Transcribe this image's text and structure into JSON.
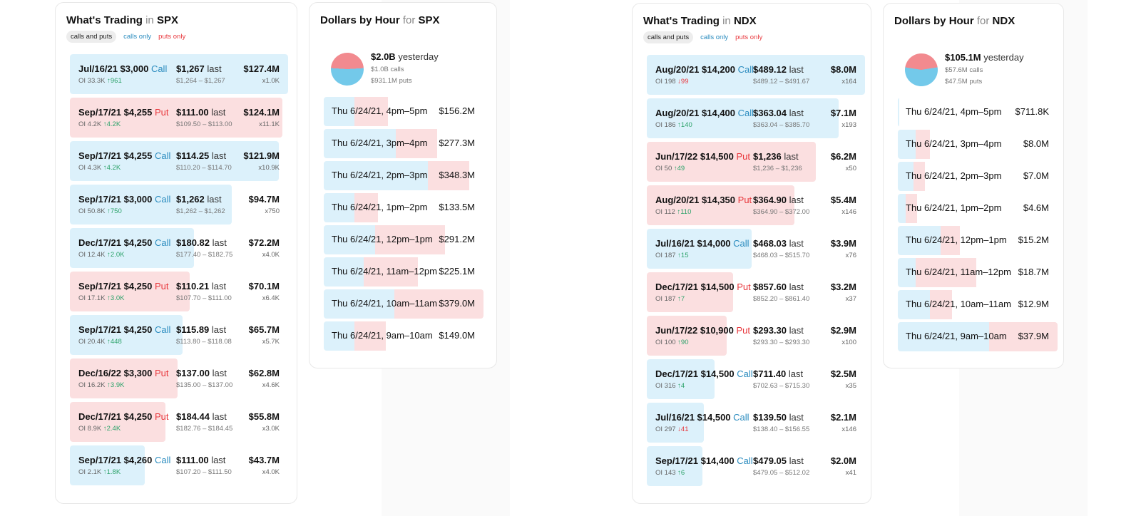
{
  "spx": {
    "trading": {
      "title_pre": "What's Trading",
      "title_sep": "in",
      "ticker": "SPX",
      "filters": {
        "all": "calls and puts",
        "calls": "calls only",
        "puts": "puts only"
      },
      "rows": [
        {
          "contract": "Jul/16/21 $3,000",
          "type": "Call",
          "oi": "OI 33.3K",
          "change_dir": "up",
          "change": "961",
          "last": "$1,267",
          "last_label": "last",
          "range": "$1,264 – $1,267",
          "premium": "$127.4M",
          "multiple": "x1.0K",
          "bar_fraction": 1.0
        },
        {
          "contract": "Sep/17/21 $4,255",
          "type": "Put",
          "oi": "OI 4.2K",
          "change_dir": "up",
          "change": "4.2K",
          "last": "$111.00",
          "last_label": "last",
          "range": "$109.50 – $113.00",
          "premium": "$124.1M",
          "multiple": "x11.1K",
          "bar_fraction": 0.974
        },
        {
          "contract": "Sep/17/21 $4,255",
          "type": "Call",
          "oi": "OI 4.3K",
          "change_dir": "up",
          "change": "4.2K",
          "last": "$114.25",
          "last_label": "last",
          "range": "$110.20 – $114.70",
          "premium": "$121.9M",
          "multiple": "x10.9K",
          "bar_fraction": 0.957
        },
        {
          "contract": "Sep/17/21 $3,000",
          "type": "Call",
          "oi": "OI 50.8K",
          "change_dir": "up",
          "change": "750",
          "last": "$1,262",
          "last_label": "last",
          "range": "$1,262 – $1,262",
          "premium": "$94.7M",
          "multiple": "x750",
          "bar_fraction": 0.743
        },
        {
          "contract": "Dec/17/21 $4,250",
          "type": "Call",
          "oi": "OI 12.4K",
          "change_dir": "up",
          "change": "2.0K",
          "last": "$180.82",
          "last_label": "last",
          "range": "$177.40 – $182.75",
          "premium": "$72.2M",
          "multiple": "x4.0K",
          "bar_fraction": 0.567
        },
        {
          "contract": "Sep/17/21 $4,250",
          "type": "Put",
          "oi": "OI 17.1K",
          "change_dir": "up",
          "change": "3.0K",
          "last": "$110.21",
          "last_label": "last",
          "range": "$107.70 – $111.00",
          "premium": "$70.1M",
          "multiple": "x6.4K",
          "bar_fraction": 0.55
        },
        {
          "contract": "Sep/17/21 $4,250",
          "type": "Call",
          "oi": "OI 20.4K",
          "change_dir": "up",
          "change": "448",
          "last": "$115.89",
          "last_label": "last",
          "range": "$113.80 – $118.08",
          "premium": "$65.7M",
          "multiple": "x5.7K",
          "bar_fraction": 0.516
        },
        {
          "contract": "Dec/16/22 $3,300",
          "type": "Put",
          "oi": "OI 16.2K",
          "change_dir": "up",
          "change": "3.9K",
          "last": "$137.00",
          "last_label": "last",
          "range": "$135.00 – $137.00",
          "premium": "$62.8M",
          "multiple": "x4.6K",
          "bar_fraction": 0.493
        },
        {
          "contract": "Dec/17/21 $4,250",
          "type": "Put",
          "oi": "OI 8.9K",
          "change_dir": "up",
          "change": "2.4K",
          "last": "$184.44",
          "last_label": "last",
          "range": "$182.76 – $184.45",
          "premium": "$55.8M",
          "multiple": "x3.0K",
          "bar_fraction": 0.438
        },
        {
          "contract": "Sep/17/21 $4,260",
          "type": "Call",
          "oi": "OI 2.1K",
          "change_dir": "up",
          "change": "1.8K",
          "last": "$111.00",
          "last_label": "last",
          "range": "$107.20 – $111.50",
          "premium": "$43.7M",
          "multiple": "x4.0K",
          "bar_fraction": 0.343
        }
      ]
    },
    "hours": {
      "title_pre": "Dollars by Hour",
      "title_sep": "for",
      "ticker": "SPX",
      "yesterday_total": "$2.0B",
      "yesterday_label": "yesterday",
      "yesterday_calls": "$1.0B calls",
      "yesterday_puts": "$931.1M puts",
      "put_share": 0.48,
      "rows": [
        {
          "label": "Thu 6/24/21, 4pm–5pm",
          "value": "$156.2M",
          "call_fraction": 0.19,
          "put_fraction": 0.21
        },
        {
          "label": "Thu 6/24/21, 3pm–4pm",
          "value": "$277.3M",
          "call_fraction": 0.45,
          "put_fraction": 0.26
        },
        {
          "label": "Thu 6/24/21, 2pm–3pm",
          "value": "$348.3M",
          "call_fraction": 0.65,
          "put_fraction": 0.26
        },
        {
          "label": "Thu 6/24/21, 1pm–2pm",
          "value": "$133.5M",
          "call_fraction": 0.19,
          "put_fraction": 0.15
        },
        {
          "label": "Thu 6/24/21, 12pm–1pm",
          "value": "$291.2M",
          "call_fraction": 0.32,
          "put_fraction": 0.44
        },
        {
          "label": "Thu 6/24/21, 11am–12pm",
          "value": "$225.1M",
          "call_fraction": 0.25,
          "put_fraction": 0.34
        },
        {
          "label": "Thu 6/24/21, 10am–11am",
          "value": "$379.0M",
          "call_fraction": 0.44,
          "put_fraction": 0.56
        },
        {
          "label": "Thu 6/24/21, 9am–10am",
          "value": "$149.0M",
          "call_fraction": 0.19,
          "put_fraction": 0.2
        }
      ]
    }
  },
  "ndx": {
    "trading": {
      "title_pre": "What's Trading",
      "title_sep": "in",
      "ticker": "NDX",
      "filters": {
        "all": "calls and puts",
        "calls": "calls only",
        "puts": "puts only"
      },
      "rows": [
        {
          "contract": "Aug/20/21 $14,200",
          "type": "Call",
          "oi": "OI 198",
          "change_dir": "down",
          "change": "99",
          "last": "$489.12",
          "last_label": "last",
          "range": "$489.12 – $491.67",
          "premium": "$8.0M",
          "multiple": "x164",
          "bar_fraction": 1.0
        },
        {
          "contract": "Aug/20/21 $14,400",
          "type": "Call",
          "oi": "OI 186",
          "change_dir": "up",
          "change": "140",
          "last": "$363.04",
          "last_label": "last",
          "range": "$363.04 – $385.70",
          "premium": "$7.1M",
          "multiple": "x193",
          "bar_fraction": 0.878
        },
        {
          "contract": "Jun/17/22 $14,500",
          "type": "Put",
          "oi": "OI 50",
          "change_dir": "up",
          "change": "49",
          "last": "$1,236",
          "last_label": "last",
          "range": "$1,236 – $1,236",
          "premium": "$6.2M",
          "multiple": "x50",
          "bar_fraction": 0.774
        },
        {
          "contract": "Aug/20/21 $14,350",
          "type": "Put",
          "oi": "OI 112",
          "change_dir": "up",
          "change": "110",
          "last": "$364.90",
          "last_label": "last",
          "range": "$364.90 – $372.00",
          "premium": "$5.4M",
          "multiple": "x146",
          "bar_fraction": 0.676
        },
        {
          "contract": "Jul/16/21 $14,000",
          "type": "Call",
          "oi": "OI 187",
          "change_dir": "up",
          "change": "15",
          "last": "$468.03",
          "last_label": "last",
          "range": "$468.03 – $515.70",
          "premium": "$3.9M",
          "multiple": "x76",
          "bar_fraction": 0.48
        },
        {
          "contract": "Dec/17/21 $14,500",
          "type": "Put",
          "oi": "OI 187",
          "change_dir": "up",
          "change": "7",
          "last": "$857.60",
          "last_label": "last",
          "range": "$852.20 – $861.40",
          "premium": "$3.2M",
          "multiple": "x37",
          "bar_fraction": 0.395
        },
        {
          "contract": "Jun/17/22 $10,900",
          "type": "Put",
          "oi": "OI 100",
          "change_dir": "up",
          "change": "90",
          "last": "$293.30",
          "last_label": "last",
          "range": "$293.30 – $293.30",
          "premium": "$2.9M",
          "multiple": "x100",
          "bar_fraction": 0.365
        },
        {
          "contract": "Dec/17/21 $14,500",
          "type": "Call",
          "oi": "OI 316",
          "change_dir": "up",
          "change": "4",
          "last": "$711.40",
          "last_label": "last",
          "range": "$702.63 – $715.30",
          "premium": "$2.5M",
          "multiple": "x35",
          "bar_fraction": 0.31
        },
        {
          "contract": "Jul/16/21 $14,500",
          "type": "Call",
          "oi": "OI 297",
          "change_dir": "down",
          "change": "41",
          "last": "$139.50",
          "last_label": "last",
          "range": "$138.40 – $156.55",
          "premium": "$2.1M",
          "multiple": "x146",
          "bar_fraction": 0.262
        },
        {
          "contract": "Sep/17/21 $14,400",
          "type": "Call",
          "oi": "OI 143",
          "change_dir": "up",
          "change": "6",
          "last": "$479.05",
          "last_label": "last",
          "range": "$479.05 – $512.02",
          "premium": "$2.0M",
          "multiple": "x41",
          "bar_fraction": 0.256
        }
      ]
    },
    "hours": {
      "title_pre": "Dollars by Hour",
      "title_sep": "for",
      "ticker": "NDX",
      "yesterday_total": "$105.1M",
      "yesterday_label": "yesterday",
      "yesterday_calls": "$57.6M calls",
      "yesterday_puts": "$47.5M puts",
      "put_share": 0.45,
      "rows": [
        {
          "label": "Thu 6/24/21, 4pm–5pm",
          "value": "$711.8K",
          "call_fraction": 0.01,
          "put_fraction": 0.0
        },
        {
          "label": "Thu 6/24/21, 3pm–4pm",
          "value": "$8.0M",
          "call_fraction": 0.11,
          "put_fraction": 0.09
        },
        {
          "label": "Thu 6/24/21, 2pm–3pm",
          "value": "$7.0M",
          "call_fraction": 0.1,
          "put_fraction": 0.07
        },
        {
          "label": "Thu 6/24/21, 1pm–2pm",
          "value": "$4.6M",
          "call_fraction": 0.05,
          "put_fraction": 0.07
        },
        {
          "label": "Thu 6/24/21, 12pm–1pm",
          "value": "$15.2M",
          "call_fraction": 0.27,
          "put_fraction": 0.12
        },
        {
          "label": "Thu 6/24/21, 11am–12pm",
          "value": "$18.7M",
          "call_fraction": 0.11,
          "put_fraction": 0.38
        },
        {
          "label": "Thu 6/24/21, 10am–11am",
          "value": "$12.9M",
          "call_fraction": 0.2,
          "put_fraction": 0.14
        },
        {
          "label": "Thu 6/24/21, 9am–10am",
          "value": "$37.9M",
          "call_fraction": 0.57,
          "put_fraction": 0.43
        }
      ]
    }
  }
}
